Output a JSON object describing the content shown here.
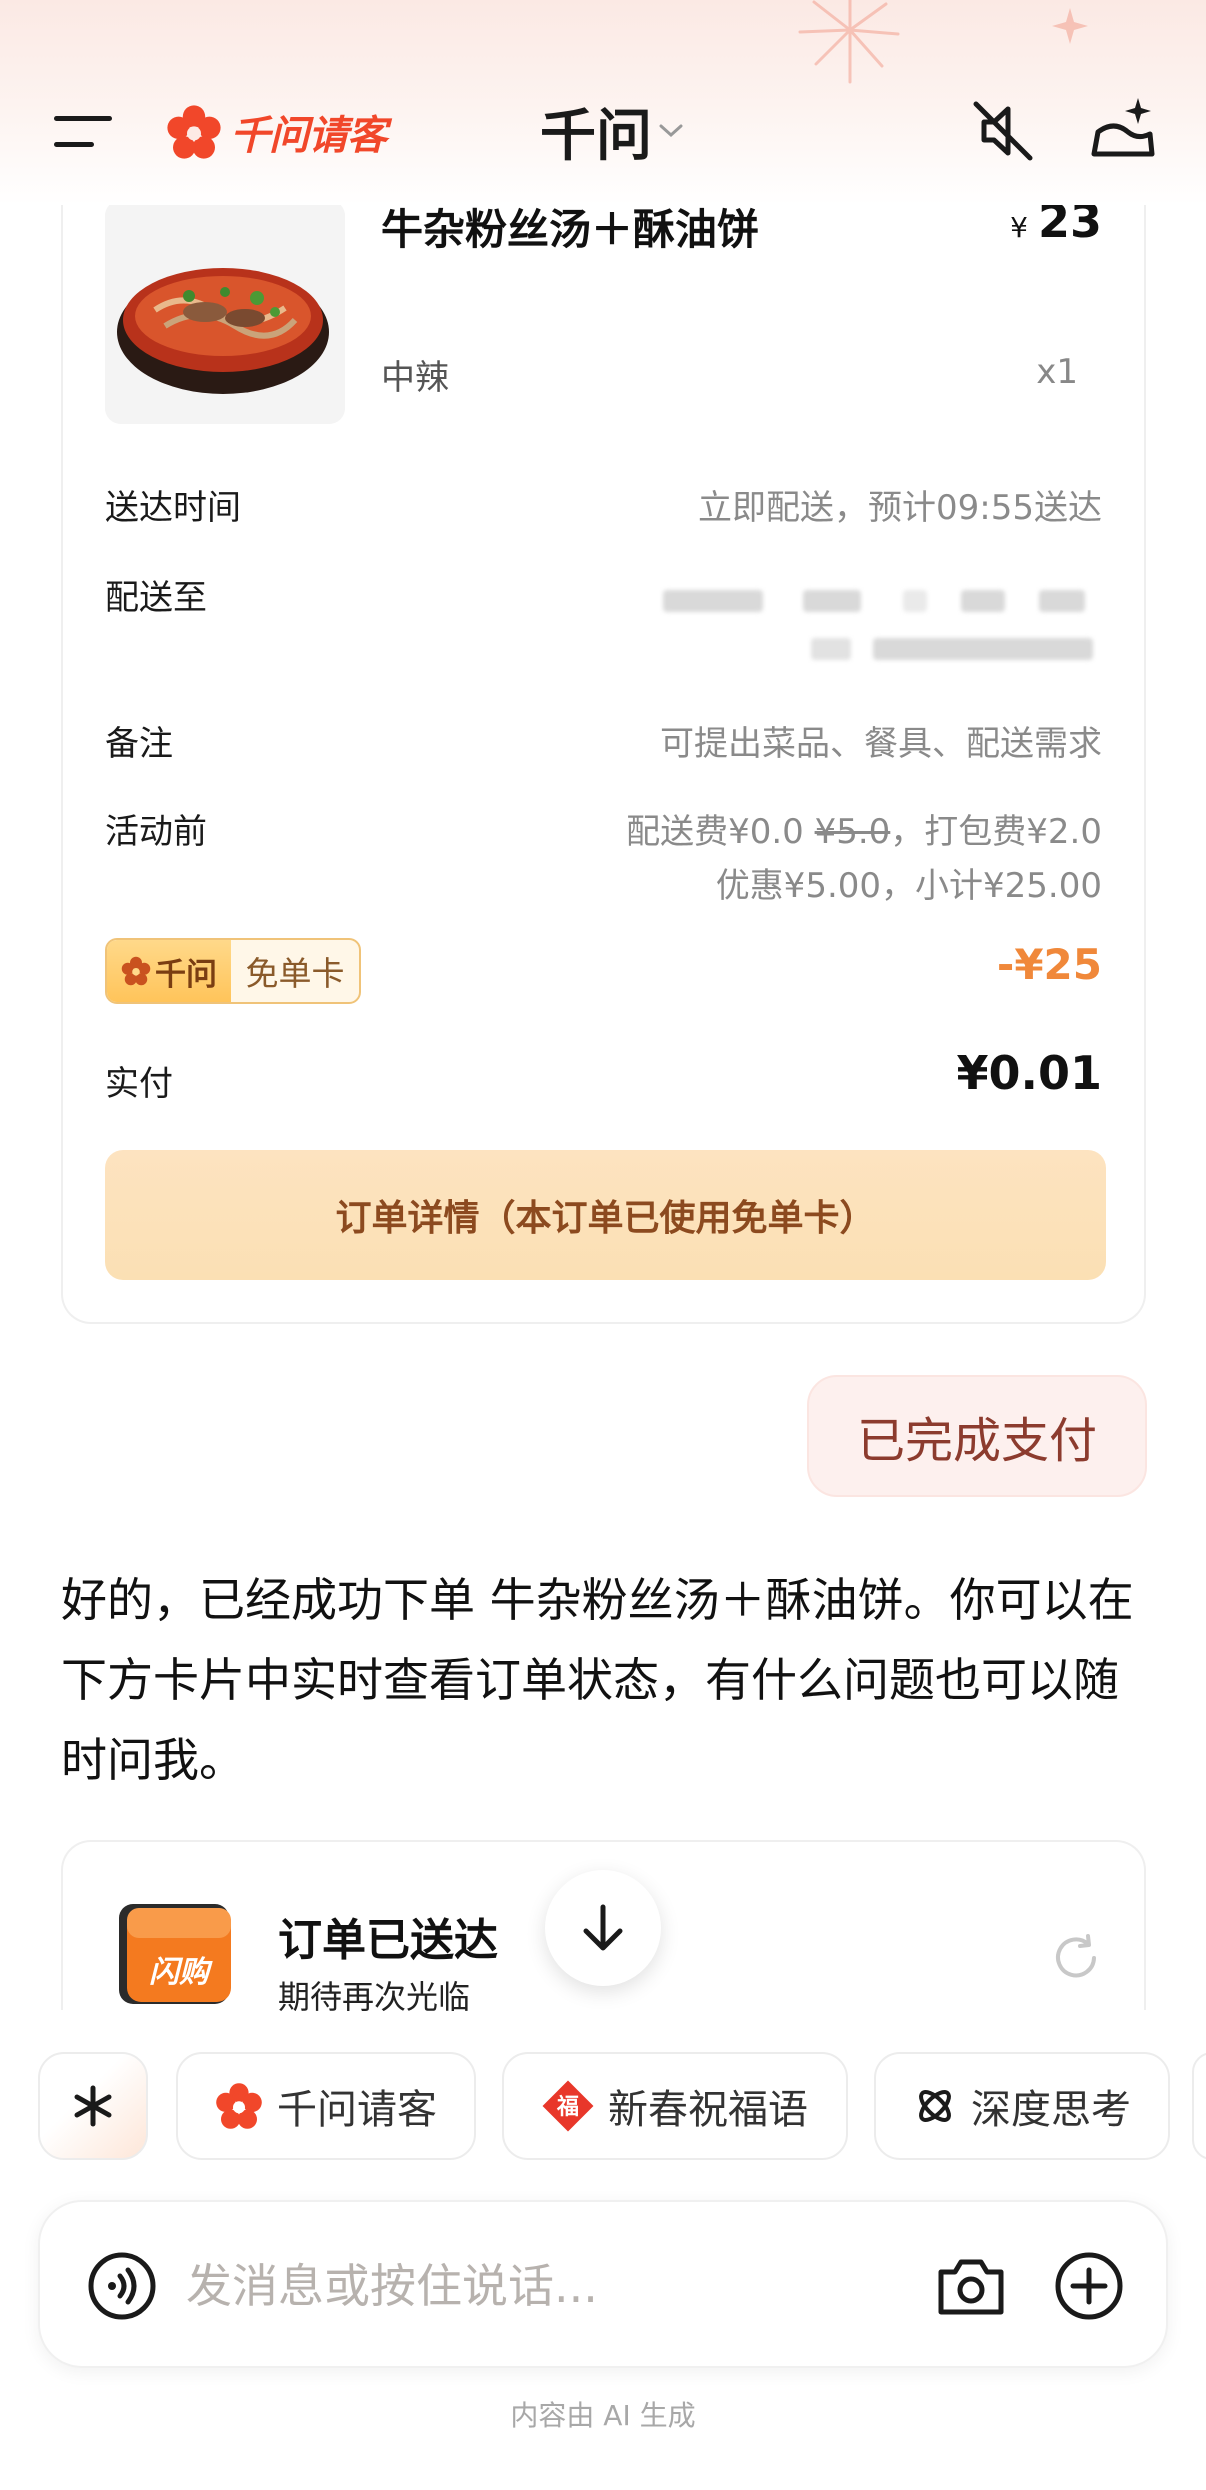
{
  "header": {
    "brand_name": "千问请客",
    "app_title": "千问",
    "icons": {
      "menu": "menu-icon",
      "brand": "flower-logo-icon",
      "dropdown": "chevron-down-icon",
      "mute": "speaker-mute-icon",
      "new_chat": "sparkle-new-chat-icon"
    }
  },
  "order": {
    "item": {
      "name": "牛杂粉丝汤＋酥油饼",
      "currency": "¥",
      "price": "23",
      "spec": "中辣",
      "qty": "x1"
    },
    "delivery_time_label": "送达时间",
    "delivery_time_value": "立即配送，预计09:55送达",
    "address_label": "配送至",
    "note_label": "备注",
    "note_value": "可提出菜品、餐具、配送需求",
    "pre_promo_label": "活动前",
    "fees": {
      "delivery_prefix": "配送费¥0.0 ",
      "delivery_original": "¥5.0",
      "packing": "，打包费¥2.0",
      "line2": "优惠¥5.00，小计¥25.00"
    },
    "badge": {
      "brand": "千问",
      "label": "免单卡"
    },
    "discount": "-¥25",
    "paid_label": "实付",
    "paid_value": "¥0.01",
    "detail_button": "订单详情（本订单已使用免单卡）"
  },
  "chat": {
    "user_message": "已完成支付",
    "ai_reply": "好的，已经成功下单 牛杂粉丝汤＋酥油饼。你可以在下方卡片中实时查看订单状态，有什么问题也可以随时问我。"
  },
  "delivery_status": {
    "title": "订单已送达",
    "subtitle": "期待再次光临",
    "icon_text": "闪购"
  },
  "quick_chips": [
    {
      "label": "千问请客",
      "icon": "flower-logo-icon"
    },
    {
      "label": "新春祝福语",
      "icon": "fu-icon"
    },
    {
      "label": "深度思考",
      "icon": "deep-think-icon"
    }
  ],
  "composer": {
    "placeholder": "发消息或按住说话...",
    "icons": {
      "voice": "voice-icon",
      "camera": "camera-icon",
      "plus": "plus-icon"
    }
  },
  "footer_note": "内容由 AI 生成",
  "colors": {
    "brand_red": "#f1472a",
    "discount_orange": "#f0883a",
    "detail_button_text": "#8c4a1f",
    "user_bubble_bg": "#fdf0ee"
  }
}
